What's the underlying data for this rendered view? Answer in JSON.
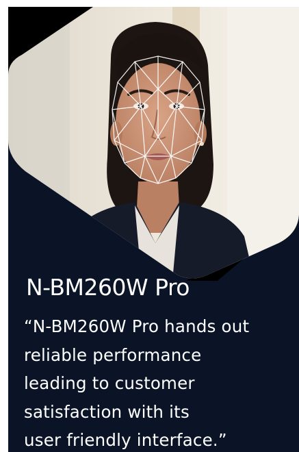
{
  "card": {
    "colors": {
      "background": "#0b1427",
      "accent_band": "#000000",
      "text": "#ffffff"
    },
    "photo": {
      "subject": "portrait-with-face-recognition-mesh",
      "icon": "face-mesh-icon"
    },
    "title": "N-BM260W Pro",
    "quote_lines": [
      "“N-BM260W Pro hands out",
      "reliable performance",
      "leading to customer",
      "satisfaction with its",
      "user friendly interface.”"
    ]
  }
}
